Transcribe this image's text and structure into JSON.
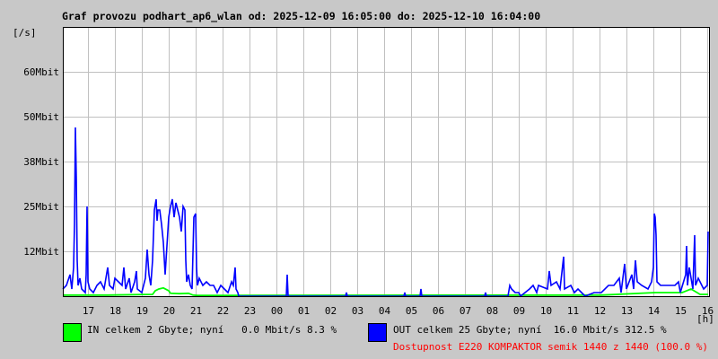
{
  "title": "Graf provozu podhart_ap6_wlan od: 2025-12-09 16:05:00 do: 2025-12-10 16:04:00",
  "chart_data": {
    "type": "line",
    "title": "Graf provozu podhart_ap6_wlan od: 2025-12-09 16:05:00 do: 2025-12-10 16:04:00",
    "ylabel": "[/s]",
    "xlabel": "[h]",
    "x_units": "minutes since 2025-12-09 16:05",
    "xlim": [
      0,
      1440
    ],
    "ylim": [
      0,
      75
    ],
    "yticks": [
      {
        "value": 62.5,
        "label": "60Mbit"
      },
      {
        "value": 50,
        "label": "50Mbit"
      },
      {
        "value": 37.5,
        "label": "38Mbit"
      },
      {
        "value": 25,
        "label": "25Mbit"
      },
      {
        "value": 12.5,
        "label": "12Mbit"
      }
    ],
    "xticks": [
      {
        "value": 56,
        "label": "17"
      },
      {
        "value": 116,
        "label": "18"
      },
      {
        "value": 176,
        "label": "19"
      },
      {
        "value": 236,
        "label": "20"
      },
      {
        "value": 296,
        "label": "21"
      },
      {
        "value": 356,
        "label": "22"
      },
      {
        "value": 416,
        "label": "23"
      },
      {
        "value": 476,
        "label": "00"
      },
      {
        "value": 536,
        "label": "01"
      },
      {
        "value": 596,
        "label": "02"
      },
      {
        "value": 656,
        "label": "03"
      },
      {
        "value": 716,
        "label": "04"
      },
      {
        "value": 776,
        "label": "05"
      },
      {
        "value": 836,
        "label": "06"
      },
      {
        "value": 896,
        "label": "07"
      },
      {
        "value": 956,
        "label": "08"
      },
      {
        "value": 1016,
        "label": "09"
      },
      {
        "value": 1076,
        "label": "10"
      },
      {
        "value": 1136,
        "label": "11"
      },
      {
        "value": 1196,
        "label": "12"
      },
      {
        "value": 1256,
        "label": "13"
      },
      {
        "value": 1316,
        "label": "14"
      },
      {
        "value": 1376,
        "label": "15"
      },
      {
        "value": 1436,
        "label": "16"
      }
    ],
    "grid": true,
    "series": [
      {
        "name": "IN",
        "color": "#00ff00",
        "points": [
          [
            0,
            0.3
          ],
          [
            100,
            0.3
          ],
          [
            200,
            0.5
          ],
          [
            206,
            1.5
          ],
          [
            214,
            2
          ],
          [
            224,
            2.3
          ],
          [
            236,
            1.5
          ],
          [
            240,
            0.8
          ],
          [
            260,
            0.7
          ],
          [
            280,
            0.8
          ],
          [
            290,
            0.3
          ],
          [
            300,
            0.2
          ],
          [
            1200,
            0.3
          ],
          [
            1320,
            1
          ],
          [
            1380,
            1
          ],
          [
            1400,
            2
          ],
          [
            1420,
            0.5
          ],
          [
            1438,
            0.5
          ]
        ]
      },
      {
        "name": "OUT",
        "color": "#0000ff",
        "points": [
          [
            0,
            2
          ],
          [
            8,
            3
          ],
          [
            16,
            6
          ],
          [
            20,
            2
          ],
          [
            24,
            8
          ],
          [
            26,
            20
          ],
          [
            28,
            47
          ],
          [
            30,
            33
          ],
          [
            32,
            10
          ],
          [
            34,
            3
          ],
          [
            38,
            5
          ],
          [
            42,
            2
          ],
          [
            50,
            1
          ],
          [
            52,
            6
          ],
          [
            54,
            25
          ],
          [
            56,
            4
          ],
          [
            60,
            2
          ],
          [
            68,
            1
          ],
          [
            76,
            3
          ],
          [
            84,
            4
          ],
          [
            92,
            2
          ],
          [
            100,
            8
          ],
          [
            104,
            3
          ],
          [
            112,
            2
          ],
          [
            116,
            5
          ],
          [
            124,
            4
          ],
          [
            132,
            3
          ],
          [
            136,
            8
          ],
          [
            140,
            2
          ],
          [
            148,
            5
          ],
          [
            152,
            1
          ],
          [
            160,
            4
          ],
          [
            164,
            7
          ],
          [
            166,
            2
          ],
          [
            176,
            1
          ],
          [
            184,
            5
          ],
          [
            188,
            13
          ],
          [
            192,
            6
          ],
          [
            196,
            3
          ],
          [
            200,
            10
          ],
          [
            204,
            24
          ],
          [
            208,
            27
          ],
          [
            210,
            21
          ],
          [
            212,
            24
          ],
          [
            216,
            24
          ],
          [
            220,
            20
          ],
          [
            224,
            15
          ],
          [
            228,
            6
          ],
          [
            232,
            14
          ],
          [
            236,
            22
          ],
          [
            240,
            25
          ],
          [
            244,
            27
          ],
          [
            248,
            22
          ],
          [
            252,
            26
          ],
          [
            256,
            24
          ],
          [
            260,
            22
          ],
          [
            264,
            18
          ],
          [
            268,
            25
          ],
          [
            272,
            24
          ],
          [
            274,
            10
          ],
          [
            276,
            4
          ],
          [
            280,
            6
          ],
          [
            284,
            3
          ],
          [
            288,
            2
          ],
          [
            292,
            22
          ],
          [
            296,
            23
          ],
          [
            298,
            8
          ],
          [
            300,
            3
          ],
          [
            304,
            5
          ],
          [
            312,
            3
          ],
          [
            320,
            4
          ],
          [
            328,
            3
          ],
          [
            336,
            3
          ],
          [
            344,
            1
          ],
          [
            352,
            3
          ],
          [
            360,
            2
          ],
          [
            368,
            1
          ],
          [
            376,
            4
          ],
          [
            380,
            3
          ],
          [
            384,
            8
          ],
          [
            386,
            2
          ],
          [
            390,
            1
          ],
          [
            392,
            0
          ],
          [
            498,
            0
          ],
          [
            500,
            6
          ],
          [
            502,
            0
          ],
          [
            630,
            0
          ],
          [
            632,
            1
          ],
          [
            634,
            0
          ],
          [
            760,
            0
          ],
          [
            762,
            1
          ],
          [
            764,
            0
          ],
          [
            796,
            0
          ],
          [
            798,
            2
          ],
          [
            800,
            0
          ],
          [
            940,
            0
          ],
          [
            942,
            1
          ],
          [
            944,
            0
          ],
          [
            992,
            0
          ],
          [
            996,
            3
          ],
          [
            1000,
            2
          ],
          [
            1008,
            1
          ],
          [
            1016,
            1
          ],
          [
            1020,
            0
          ],
          [
            1040,
            2
          ],
          [
            1048,
            3
          ],
          [
            1056,
            1
          ],
          [
            1060,
            3
          ],
          [
            1080,
            2
          ],
          [
            1084,
            7
          ],
          [
            1088,
            3
          ],
          [
            1100,
            4
          ],
          [
            1108,
            2
          ],
          [
            1116,
            11
          ],
          [
            1118,
            2
          ],
          [
            1132,
            3
          ],
          [
            1140,
            1
          ],
          [
            1148,
            2
          ],
          [
            1164,
            0
          ],
          [
            1184,
            1
          ],
          [
            1200,
            1
          ],
          [
            1216,
            3
          ],
          [
            1228,
            3
          ],
          [
            1240,
            5
          ],
          [
            1244,
            1
          ],
          [
            1252,
            9
          ],
          [
            1256,
            2
          ],
          [
            1268,
            6
          ],
          [
            1272,
            2
          ],
          [
            1276,
            10
          ],
          [
            1280,
            4
          ],
          [
            1290,
            3
          ],
          [
            1304,
            2
          ],
          [
            1312,
            4
          ],
          [
            1316,
            8
          ],
          [
            1318,
            23
          ],
          [
            1320,
            22
          ],
          [
            1322,
            17
          ],
          [
            1324,
            4
          ],
          [
            1332,
            3
          ],
          [
            1348,
            3
          ],
          [
            1364,
            3
          ],
          [
            1372,
            4
          ],
          [
            1376,
            1
          ],
          [
            1388,
            6
          ],
          [
            1390,
            14
          ],
          [
            1392,
            3
          ],
          [
            1396,
            8
          ],
          [
            1404,
            2
          ],
          [
            1408,
            17
          ],
          [
            1410,
            3
          ],
          [
            1416,
            5
          ],
          [
            1428,
            2
          ],
          [
            1436,
            3
          ],
          [
            1438,
            18
          ]
        ]
      }
    ]
  },
  "legend": {
    "in_text": "IN celkem 2 Gbyte; nyní   0.0 Mbit/s 8.3 %",
    "out_text": "OUT celkem 25 Gbyte; nyní  16.0 Mbit/s 312.5 %",
    "in_color": "#00ff00",
    "out_color": "#0000ff"
  },
  "availability": "Dostupnost E220 KOMPAKTOR semik 1440 z 1440 (100.0 %)"
}
